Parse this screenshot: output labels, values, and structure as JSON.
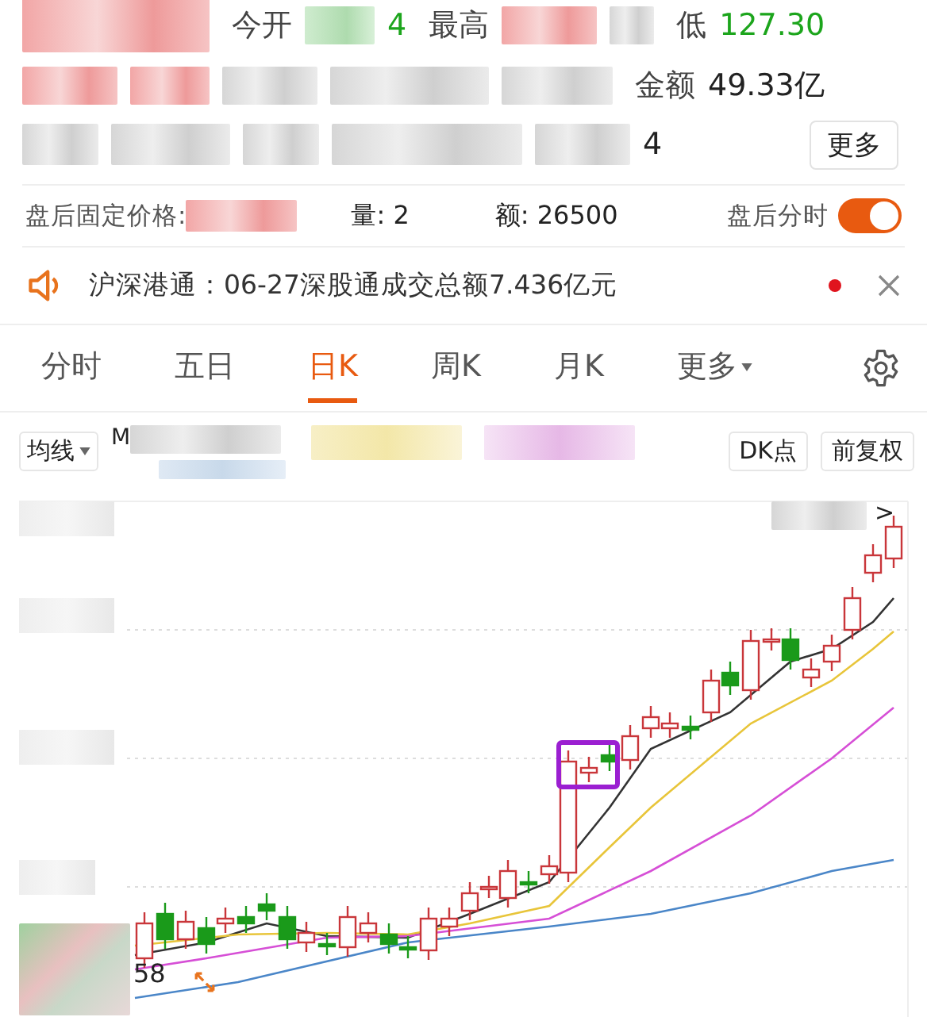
{
  "quote": {
    "open_label": "今开",
    "open_value_tail": "4",
    "high_label": "最高",
    "low_label": "低",
    "low_value": "127.30",
    "amount_label": "金额",
    "amount_value": "49.33亿",
    "row3_tail": "4",
    "more_button": "更多"
  },
  "after_hours": {
    "price_label": "盘后固定价格:",
    "volume": "量: 2",
    "amount": "额: 26500",
    "intraday_label": "盘后分时",
    "intraday_on": true
  },
  "notice": {
    "text": "沪深港通：06-27深股通成交总额7.436亿元",
    "unread": true
  },
  "tabs": [
    {
      "label": "分时",
      "selected": false,
      "kind": "tab"
    },
    {
      "label": "五日",
      "selected": false,
      "kind": "tab"
    },
    {
      "label": "日K",
      "selected": true,
      "kind": "tab"
    },
    {
      "label": "周K",
      "selected": false,
      "kind": "tab"
    },
    {
      "label": "月K",
      "selected": false,
      "kind": "tab"
    },
    {
      "label": "更多",
      "selected": false,
      "kind": "menu"
    }
  ],
  "toolbar": {
    "indicator": "均线",
    "legend_prefix": "M",
    "dk_button": "DK点",
    "adjust_button": "前复权"
  },
  "chart": {
    "price_tail": "58",
    "next_arrow": ">"
  }
}
